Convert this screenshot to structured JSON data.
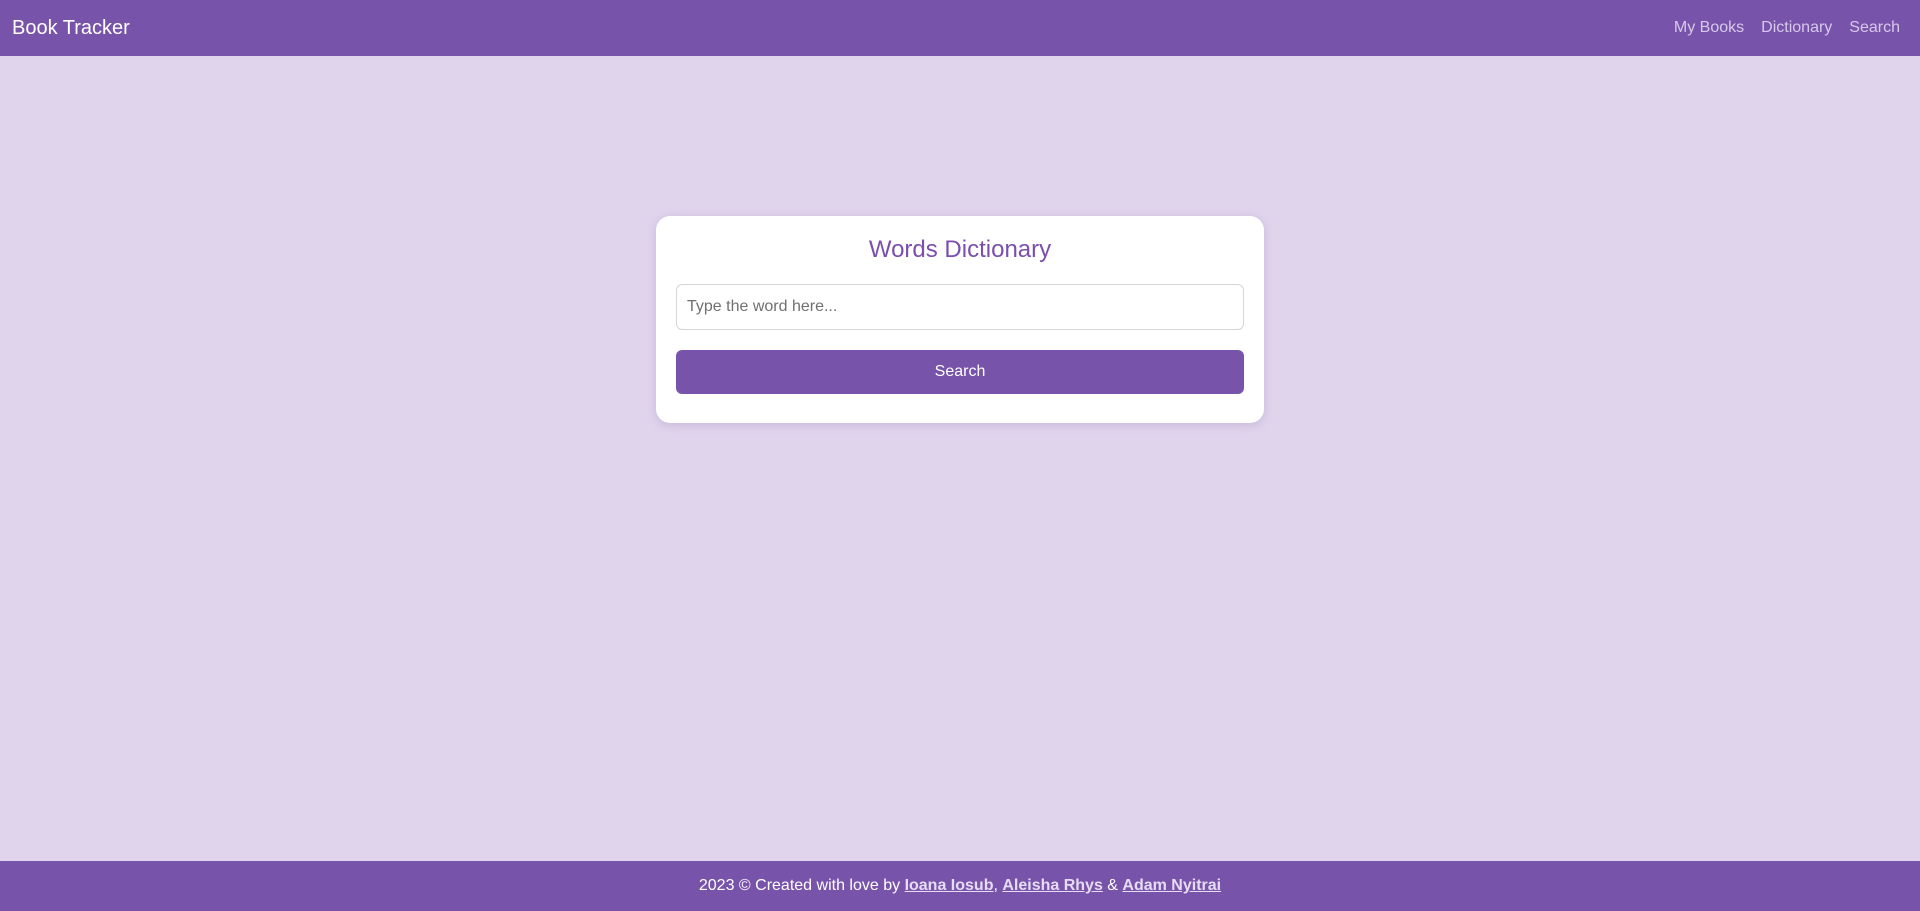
{
  "navbar": {
    "brand": "Book Tracker",
    "links": [
      "My Books",
      "Dictionary",
      "Search"
    ]
  },
  "dictionary_card": {
    "title": "Words Dictionary",
    "input_placeholder": "Type the word here...",
    "input_value": "",
    "search_button_label": "Search"
  },
  "footer": {
    "prefix": "2023 © Created with love by ",
    "authors": [
      "Ioana Iosub",
      "Aleisha Rhys",
      "Adam Nyitrai"
    ],
    "separator_comma": ", ",
    "separator_and": " & "
  },
  "colors": {
    "primary": "#7853aa",
    "background": "#e0d4ed",
    "title": "#7a4fae"
  }
}
